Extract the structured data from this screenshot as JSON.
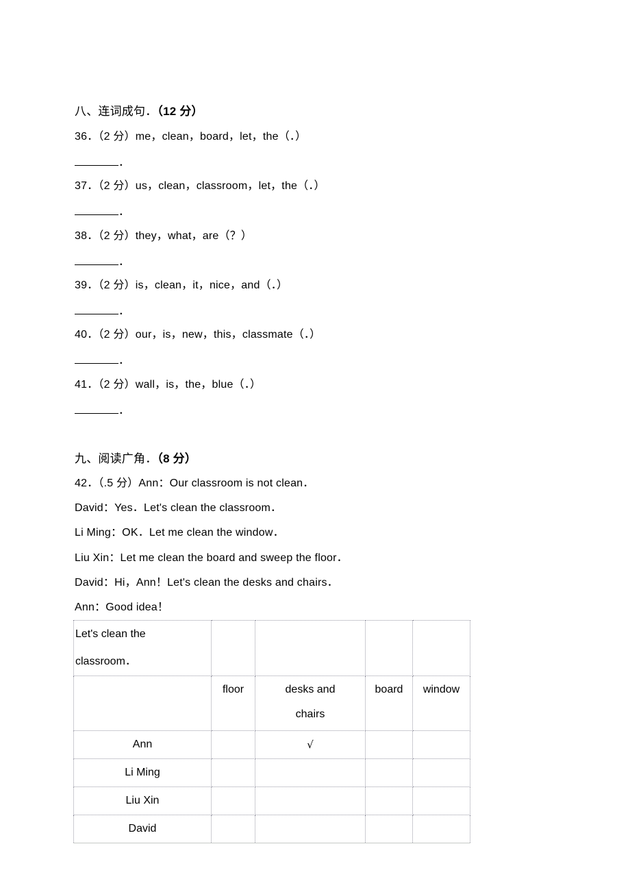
{
  "section8": {
    "number": "八、连词成句．",
    "points": "（12 分）",
    "questions": [
      {
        "id": "36",
        "prefix": "36．（2 分）",
        "words": "me，clean，board，let，the（．）",
        "answer_suffix": "．"
      },
      {
        "id": "37",
        "prefix": "37．（2 分）",
        "words": "us，clean，classroom，let，the（．）",
        "answer_suffix": "．"
      },
      {
        "id": "38",
        "prefix": "38．（2 分）",
        "words": "they，what，are（？）",
        "answer_suffix": "．"
      },
      {
        "id": "39",
        "prefix": "39．（2 分）",
        "words": "is，clean，it，nice，and（．）",
        "answer_suffix": "．"
      },
      {
        "id": "40",
        "prefix": "40．（2 分）",
        "words": "our，is，new，this，classmate（．）",
        "answer_suffix": "．"
      },
      {
        "id": "41",
        "prefix": "41．（2 分）",
        "words": "wall，is，the，blue（．）",
        "answer_suffix": "．"
      }
    ]
  },
  "section9": {
    "number": "九、阅读广角．",
    "points": "（8 分）",
    "question": {
      "prefix": "42．（.5 分）",
      "dialogue": [
        "Ann：Our classroom is not clean．",
        "David：Yes．Let's clean the classroom．",
        "Li Ming：OK．Let me clean the window．",
        "Liu Xin：Let me clean the board and sweep the floor．",
        "David：Hi，Ann！Let's clean the desks and chairs．",
        "Ann：Good idea！"
      ]
    },
    "table": {
      "title": "Let's clean the classroom．",
      "columns": [
        "floor",
        "desks and chairs",
        "board",
        "window"
      ],
      "rows": [
        {
          "name": "Ann",
          "cells": [
            "",
            "√",
            "",
            ""
          ]
        },
        {
          "name": "Li Ming",
          "cells": [
            "",
            "",
            "",
            ""
          ]
        },
        {
          "name": "Liu Xin",
          "cells": [
            "",
            "",
            "",
            ""
          ]
        },
        {
          "name": "David",
          "cells": [
            "",
            "",
            "",
            ""
          ]
        }
      ]
    }
  }
}
